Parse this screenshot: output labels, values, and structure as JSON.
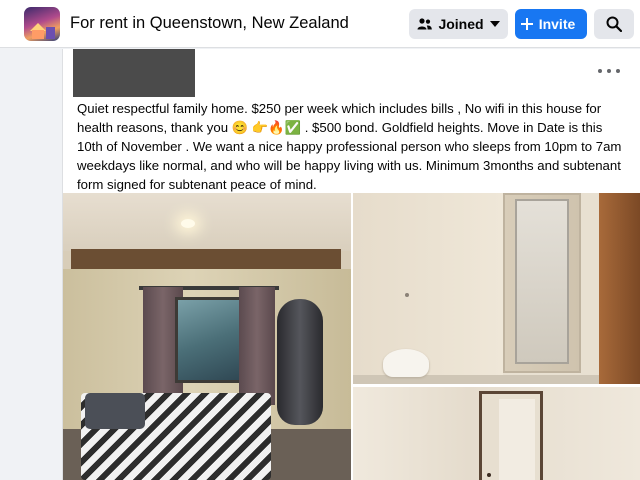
{
  "group": {
    "title": "For rent in Queenstown, New Zealand",
    "thumbnail_icon": "group-cover-image"
  },
  "actions": {
    "joined_label": "Joined",
    "joined_icon": "people-icon",
    "joined_chevron": "chevron-down-icon",
    "invite_label": "Invite",
    "invite_icon": "plus-icon",
    "search_icon": "search-icon"
  },
  "colors": {
    "accent": "#1877f2",
    "button_gray": "#e4e6eb",
    "page_bg": "#f0f2f5",
    "text": "#050505",
    "redaction": "#4b4b4b"
  },
  "post": {
    "more_icon": "more-options-icon",
    "text": "Quiet respectful family home. $250 per week which includes bills , No wifi in this house for health reasons, thank you 😊 👉🔥✅ . $500 bond. Goldfield heights. Move in Date is this 10th of November . We want a nice happy professional person who sleeps from 10pm to 7am weekdays like normal, and who will be happy living with us. Minimum 3months and subtenant form signed for subtenant peace of mind.",
    "photos": [
      "bedroom-photo",
      "bathroom-photo",
      "hallway-photo"
    ]
  }
}
